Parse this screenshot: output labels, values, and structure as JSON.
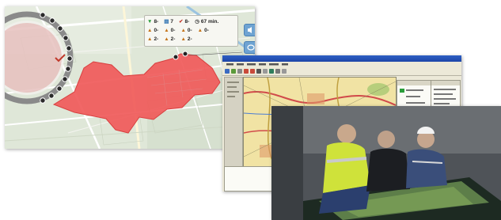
{
  "map_app": {
    "legend": {
      "row1": [
        {
          "icon": "green-arrow-icon",
          "value": "8-"
        },
        {
          "icon": "chart-icon",
          "value": "7"
        },
        {
          "icon": "checkmark-icon",
          "value": "8-"
        },
        {
          "icon": "clock-icon",
          "value": "67 min."
        }
      ],
      "row2": [
        {
          "icon": "warning-triangle-icon",
          "value": "0-"
        },
        {
          "icon": "warning-triangle-icon",
          "value": "0-"
        },
        {
          "icon": "warning-triangle-icon",
          "value": "0-"
        },
        {
          "icon": "warning-triangle-icon",
          "value": "0-"
        }
      ],
      "row3": [
        {
          "icon": "warning-triangle-icon",
          "value": "2-"
        },
        {
          "icon": "warning-triangle-icon",
          "value": "2-"
        },
        {
          "icon": "warning-triangle-icon",
          "value": "2-"
        }
      ]
    },
    "colors": {
      "zone": "#f05a5a",
      "water": "#9bc3e0",
      "land": "#dfe7d8",
      "button": "#6ea3d2"
    }
  },
  "gis_app": {
    "title": "",
    "menu": [],
    "colors": {
      "titlebar": "#1c45a8",
      "map": "#f1e3a4",
      "chrome": "#ece9d8"
    }
  }
}
